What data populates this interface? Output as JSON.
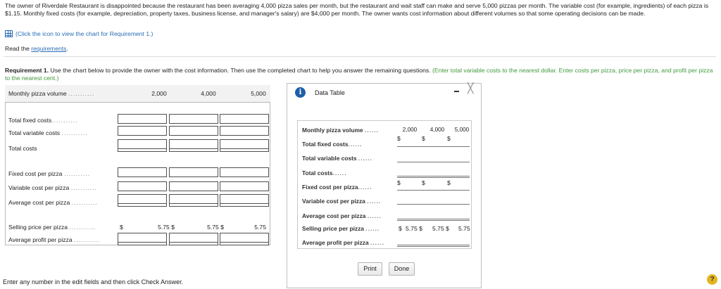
{
  "intro": "The owner of Riverdale Restaurant is disappointed because the restaurant has been averaging 4,000 pizza sales per month, but the restaurant and wait staff can make and serve 5,000 pizzas per month. The variable cost (for example, ingredients) of each pizza is $1.15. Monthly fixed costs (for example, depreciation, property taxes, business license, and manager's salary) are $4,000 per month. The owner wants cost information about different volumes so that some operating decisions can be made.",
  "chart_link": "(Click the icon to view the chart for Requirement 1.)",
  "read_prefix": "Read the ",
  "read_link": "requirements",
  "read_suffix": ".",
  "requirement": {
    "label": "Requirement 1.",
    "text": " Use the chart below to provide the owner with the cost information. Then use the completed chart to help you answer the remaining questions. ",
    "hint": "(Enter total variable costs to the nearest dollar. Enter costs per pizza, price per pizza, and profit per pizza to the nearest cent.)"
  },
  "main_table": {
    "header_label": "Monthly pizza volume",
    "volumes": [
      "2,000",
      "4,000",
      "5,000"
    ],
    "rows": {
      "total_fixed": "Total fixed costs",
      "total_variable": "Total variable costs",
      "total_costs": "Total costs",
      "fixed_per": "Fixed cost per pizza",
      "variable_per": "Variable cost per pizza",
      "average_per": "Average cost per pizza",
      "selling_price": "Selling price per pizza",
      "average_profit": "Average profit per pizza"
    },
    "dots": "...........",
    "dollar": "$",
    "selling_prices": [
      "5.75 $",
      "5.75 $",
      "5.75"
    ]
  },
  "bottom_message": "Enter any number in the edit fields and then click Check Answer.",
  "popup": {
    "title": "Data Table",
    "info_glyph": "i",
    "close_glyph": "╳",
    "header_label": "Monthly pizza volume",
    "volumes": [
      "2,000",
      "4,000",
      "5,000"
    ],
    "dots": "......",
    "rows": [
      "Total fixed costs",
      "Total variable costs",
      "Total costs",
      "Fixed cost per pizza",
      "Variable cost per pizza",
      "Average cost per pizza",
      "Selling price per pizza",
      "Average profit per pizza"
    ],
    "dollar": "$",
    "selling_prices": [
      "5.75 $",
      "5.75 $",
      "5.75"
    ],
    "print_button": "Print",
    "done_button": "Done"
  },
  "help_glyph": "?"
}
